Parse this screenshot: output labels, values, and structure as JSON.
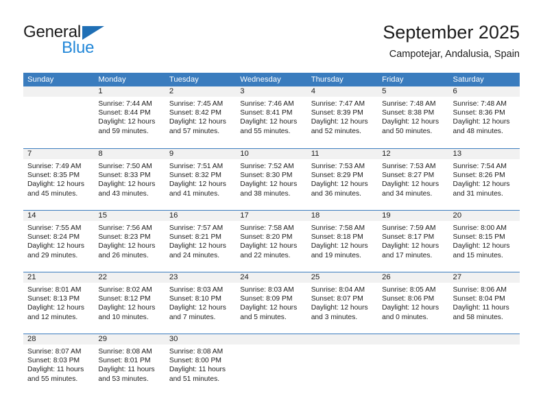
{
  "brand": {
    "name_part1": "General",
    "name_part2": "Blue",
    "triangle_color": "#1f6fb5",
    "blue_text_color": "#2287d8"
  },
  "header": {
    "title": "September 2025",
    "subtitle": "Campotejar, Andalusia, Spain"
  },
  "theme": {
    "header_blue": "#3a7cbe",
    "daynum_band": "#f1f1f1"
  },
  "weekdays": [
    "Sunday",
    "Monday",
    "Tuesday",
    "Wednesday",
    "Thursday",
    "Friday",
    "Saturday"
  ],
  "weeks": [
    [
      {
        "day": "",
        "lines": []
      },
      {
        "day": "1",
        "lines": [
          "Sunrise: 7:44 AM",
          "Sunset: 8:44 PM",
          "Daylight: 12 hours",
          "and 59 minutes."
        ]
      },
      {
        "day": "2",
        "lines": [
          "Sunrise: 7:45 AM",
          "Sunset: 8:42 PM",
          "Daylight: 12 hours",
          "and 57 minutes."
        ]
      },
      {
        "day": "3",
        "lines": [
          "Sunrise: 7:46 AM",
          "Sunset: 8:41 PM",
          "Daylight: 12 hours",
          "and 55 minutes."
        ]
      },
      {
        "day": "4",
        "lines": [
          "Sunrise: 7:47 AM",
          "Sunset: 8:39 PM",
          "Daylight: 12 hours",
          "and 52 minutes."
        ]
      },
      {
        "day": "5",
        "lines": [
          "Sunrise: 7:48 AM",
          "Sunset: 8:38 PM",
          "Daylight: 12 hours",
          "and 50 minutes."
        ]
      },
      {
        "day": "6",
        "lines": [
          "Sunrise: 7:48 AM",
          "Sunset: 8:36 PM",
          "Daylight: 12 hours",
          "and 48 minutes."
        ]
      }
    ],
    [
      {
        "day": "7",
        "lines": [
          "Sunrise: 7:49 AM",
          "Sunset: 8:35 PM",
          "Daylight: 12 hours",
          "and 45 minutes."
        ]
      },
      {
        "day": "8",
        "lines": [
          "Sunrise: 7:50 AM",
          "Sunset: 8:33 PM",
          "Daylight: 12 hours",
          "and 43 minutes."
        ]
      },
      {
        "day": "9",
        "lines": [
          "Sunrise: 7:51 AM",
          "Sunset: 8:32 PM",
          "Daylight: 12 hours",
          "and 41 minutes."
        ]
      },
      {
        "day": "10",
        "lines": [
          "Sunrise: 7:52 AM",
          "Sunset: 8:30 PM",
          "Daylight: 12 hours",
          "and 38 minutes."
        ]
      },
      {
        "day": "11",
        "lines": [
          "Sunrise: 7:53 AM",
          "Sunset: 8:29 PM",
          "Daylight: 12 hours",
          "and 36 minutes."
        ]
      },
      {
        "day": "12",
        "lines": [
          "Sunrise: 7:53 AM",
          "Sunset: 8:27 PM",
          "Daylight: 12 hours",
          "and 34 minutes."
        ]
      },
      {
        "day": "13",
        "lines": [
          "Sunrise: 7:54 AM",
          "Sunset: 8:26 PM",
          "Daylight: 12 hours",
          "and 31 minutes."
        ]
      }
    ],
    [
      {
        "day": "14",
        "lines": [
          "Sunrise: 7:55 AM",
          "Sunset: 8:24 PM",
          "Daylight: 12 hours",
          "and 29 minutes."
        ]
      },
      {
        "day": "15",
        "lines": [
          "Sunrise: 7:56 AM",
          "Sunset: 8:23 PM",
          "Daylight: 12 hours",
          "and 26 minutes."
        ]
      },
      {
        "day": "16",
        "lines": [
          "Sunrise: 7:57 AM",
          "Sunset: 8:21 PM",
          "Daylight: 12 hours",
          "and 24 minutes."
        ]
      },
      {
        "day": "17",
        "lines": [
          "Sunrise: 7:58 AM",
          "Sunset: 8:20 PM",
          "Daylight: 12 hours",
          "and 22 minutes."
        ]
      },
      {
        "day": "18",
        "lines": [
          "Sunrise: 7:58 AM",
          "Sunset: 8:18 PM",
          "Daylight: 12 hours",
          "and 19 minutes."
        ]
      },
      {
        "day": "19",
        "lines": [
          "Sunrise: 7:59 AM",
          "Sunset: 8:17 PM",
          "Daylight: 12 hours",
          "and 17 minutes."
        ]
      },
      {
        "day": "20",
        "lines": [
          "Sunrise: 8:00 AM",
          "Sunset: 8:15 PM",
          "Daylight: 12 hours",
          "and 15 minutes."
        ]
      }
    ],
    [
      {
        "day": "21",
        "lines": [
          "Sunrise: 8:01 AM",
          "Sunset: 8:13 PM",
          "Daylight: 12 hours",
          "and 12 minutes."
        ]
      },
      {
        "day": "22",
        "lines": [
          "Sunrise: 8:02 AM",
          "Sunset: 8:12 PM",
          "Daylight: 12 hours",
          "and 10 minutes."
        ]
      },
      {
        "day": "23",
        "lines": [
          "Sunrise: 8:03 AM",
          "Sunset: 8:10 PM",
          "Daylight: 12 hours",
          "and 7 minutes."
        ]
      },
      {
        "day": "24",
        "lines": [
          "Sunrise: 8:03 AM",
          "Sunset: 8:09 PM",
          "Daylight: 12 hours",
          "and 5 minutes."
        ]
      },
      {
        "day": "25",
        "lines": [
          "Sunrise: 8:04 AM",
          "Sunset: 8:07 PM",
          "Daylight: 12 hours",
          "and 3 minutes."
        ]
      },
      {
        "day": "26",
        "lines": [
          "Sunrise: 8:05 AM",
          "Sunset: 8:06 PM",
          "Daylight: 12 hours",
          "and 0 minutes."
        ]
      },
      {
        "day": "27",
        "lines": [
          "Sunrise: 8:06 AM",
          "Sunset: 8:04 PM",
          "Daylight: 11 hours",
          "and 58 minutes."
        ]
      }
    ],
    [
      {
        "day": "28",
        "lines": [
          "Sunrise: 8:07 AM",
          "Sunset: 8:03 PM",
          "Daylight: 11 hours",
          "and 55 minutes."
        ]
      },
      {
        "day": "29",
        "lines": [
          "Sunrise: 8:08 AM",
          "Sunset: 8:01 PM",
          "Daylight: 11 hours",
          "and 53 minutes."
        ]
      },
      {
        "day": "30",
        "lines": [
          "Sunrise: 8:08 AM",
          "Sunset: 8:00 PM",
          "Daylight: 11 hours",
          "and 51 minutes."
        ]
      },
      {
        "day": "",
        "lines": []
      },
      {
        "day": "",
        "lines": []
      },
      {
        "day": "",
        "lines": []
      },
      {
        "day": "",
        "lines": []
      }
    ]
  ]
}
